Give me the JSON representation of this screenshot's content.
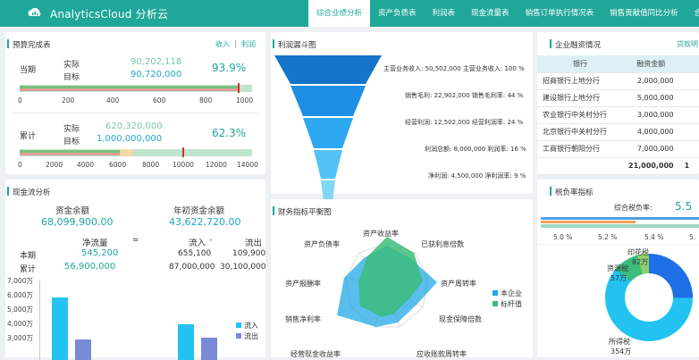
{
  "app": {
    "title": "AnalyticsCloud 分析云"
  },
  "nav": [
    "综合业绩分析",
    "资产负债表",
    "利润表",
    "现金流量表",
    "销售订单执行情况表",
    "销售贡献值同比分析",
    "合并"
  ],
  "budget": {
    "title": "预算完成表",
    "link_income": "收入",
    "sep": "|",
    "link_profit": "利润",
    "current": {
      "label": "当期",
      "actual_label": "实际",
      "target_label": "目标",
      "actual": "90,202,118",
      "target": "90,720,000",
      "pct": "93.9%",
      "progress": 0.939
    },
    "cumulative": {
      "label": "累计",
      "actual_label": "实际",
      "target_label": "目标",
      "actual": "620,320,000",
      "target": "1,000,000,000",
      "pct": "62.3%",
      "progress": 0.623
    },
    "axis1": [
      "0",
      "200",
      "400",
      "600",
      "800",
      "1000"
    ],
    "axis2": [
      "0",
      "2000",
      "4000",
      "6000",
      "8000",
      "10000",
      "12000",
      "14000"
    ]
  },
  "cash": {
    "title": "现金流分析",
    "balance_label": "资金余额",
    "balance": "68,099,900.00",
    "initial_label": "年初资金余额",
    "initial": "43,622,720.00",
    "hdr_net": "净流量",
    "hdr_eq": "=",
    "hdr_in": "流入",
    "hdr_minus": "-",
    "hdr_out": "流出",
    "rows": [
      {
        "label": "本期",
        "net": "545,200",
        "in": "655,100",
        "out": "109,900"
      },
      {
        "label": "累计",
        "net": "56,900,000",
        "in": "87,000,000",
        "out": "30,100,000"
      }
    ],
    "yticks": [
      "7,000万",
      "6,000万",
      "5,000万",
      "4,000万",
      "3,000万"
    ],
    "legend": [
      "流入",
      "流出"
    ]
  },
  "funnel": {
    "title": "利润漏斗图",
    "labels": [
      "主营业务收入: 50,502,000 主营业务收入: 100 %",
      "销售毛利: 22,902,000 销售毛利率: 44 %",
      "经营利润: 12,502,000 经营利润率: 24 %",
      "利润总额: 8,000,000 利润率: 16 %",
      "净利润: 4,500,000 净利润率: 9 %"
    ]
  },
  "radar": {
    "title": "财务指标平衡图",
    "axes": [
      "资产收益率",
      "已获利息倍数",
      "资产周转率",
      "现金保障倍数",
      "应收账款周转率",
      "经营现金收益率",
      "销售净利率",
      "资产报酬率",
      "资产负债率"
    ],
    "legend": [
      "本企业",
      "标杆值"
    ]
  },
  "finance": {
    "title": "企业融资情况",
    "link": "贷款明",
    "headers": [
      "银行",
      "融资金额",
      ""
    ],
    "rows": [
      [
        "招商银行上地分行",
        "2,000,000",
        ""
      ],
      [
        "建设银行上地分行",
        "5,000,000",
        ""
      ],
      [
        "农业银行中关村分行",
        "3,000,000",
        ""
      ],
      [
        "北京银行中关村分行",
        "4,000,000",
        ""
      ],
      [
        "工商银行朝阳分行",
        "7,000,000",
        ""
      ]
    ],
    "total": "21,000,000",
    "total_extra": "1"
  },
  "tax": {
    "title": "税负率指标",
    "overall_label": "综合税负率:",
    "overall": "5.5",
    "ticks": [
      "5.0 %",
      "5.2 %",
      "5.4 %",
      "5."
    ],
    "donut_labels": [
      {
        "name": "印花税",
        "value": "82万"
      },
      {
        "name": "资源税",
        "value": "57万"
      },
      {
        "name": "所得税",
        "value": "354万"
      }
    ]
  },
  "colors": {
    "accent": "#1fa79a",
    "blue": "#1f8fe6",
    "cyan": "#22c3f0",
    "purple": "#7b8ad6"
  }
}
